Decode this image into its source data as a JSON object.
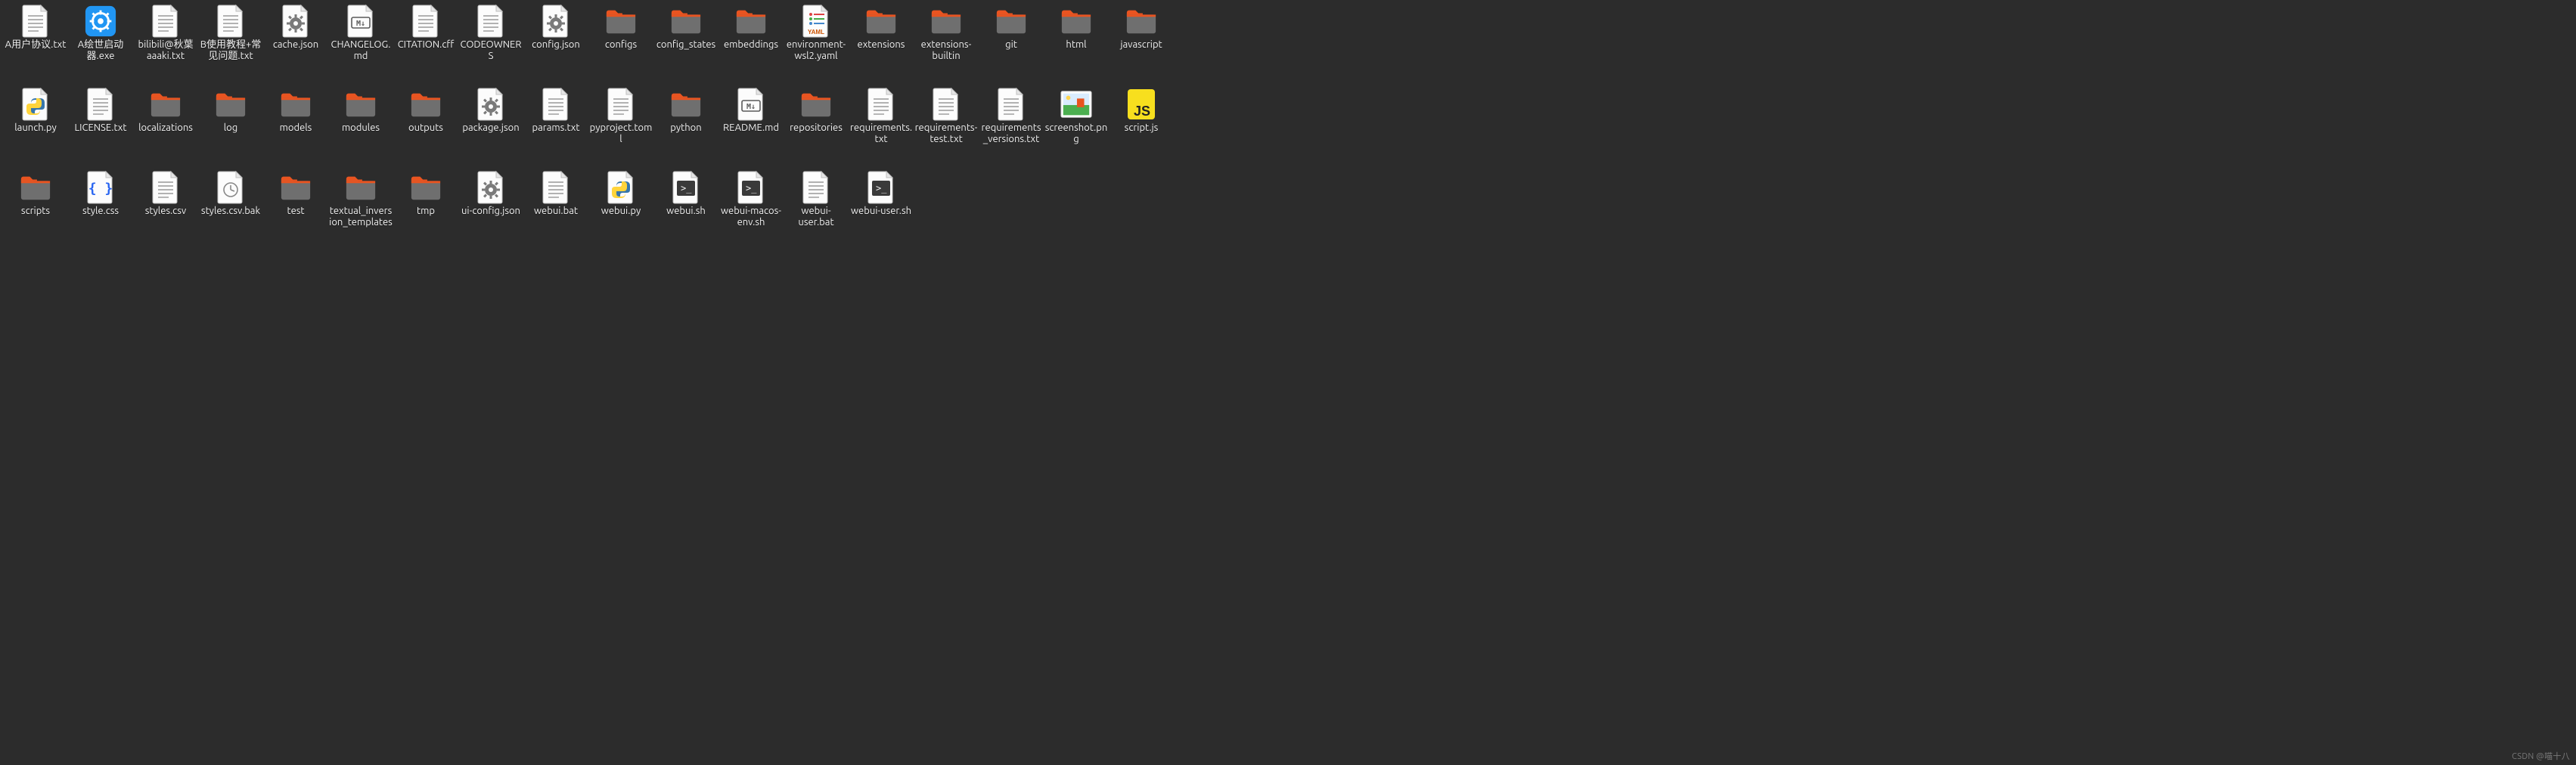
{
  "watermark": "CSDN @喵十八",
  "items": [
    {
      "label": "A用户协议.txt",
      "kind": "text"
    },
    {
      "label": "A绘世启动器.exe",
      "kind": "exe"
    },
    {
      "label": "bilibili@秋葉aaaki.txt",
      "kind": "text"
    },
    {
      "label": "B使用教程+常见问题.txt",
      "kind": "text"
    },
    {
      "label": "cache.json",
      "kind": "json-gear"
    },
    {
      "label": "CHANGELOG.md",
      "kind": "md"
    },
    {
      "label": "CITATION.cff",
      "kind": "text"
    },
    {
      "label": "CODEOWNERS",
      "kind": "text"
    },
    {
      "label": "config.json",
      "kind": "json-gear"
    },
    {
      "label": "configs",
      "kind": "folder"
    },
    {
      "label": "config_states",
      "kind": "folder"
    },
    {
      "label": "embeddings",
      "kind": "folder"
    },
    {
      "label": "environment-wsl2.yaml",
      "kind": "yaml"
    },
    {
      "label": "extensions",
      "kind": "folder"
    },
    {
      "label": "extensions-builtin",
      "kind": "folder"
    },
    {
      "label": "git",
      "kind": "folder"
    },
    {
      "label": "html",
      "kind": "folder"
    },
    {
      "label": "javascript",
      "kind": "folder"
    },
    {
      "label": "launch.py",
      "kind": "python"
    },
    {
      "label": "LICENSE.txt",
      "kind": "text"
    },
    {
      "label": "localizations",
      "kind": "folder"
    },
    {
      "label": "log",
      "kind": "folder"
    },
    {
      "label": "models",
      "kind": "folder"
    },
    {
      "label": "modules",
      "kind": "folder"
    },
    {
      "label": "outputs",
      "kind": "folder"
    },
    {
      "label": "package.json",
      "kind": "json-gear"
    },
    {
      "label": "params.txt",
      "kind": "text"
    },
    {
      "label": "pyproject.toml",
      "kind": "text"
    },
    {
      "label": "python",
      "kind": "folder"
    },
    {
      "label": "README.md",
      "kind": "md"
    },
    {
      "label": "repositories",
      "kind": "folder"
    },
    {
      "label": "requirements.txt",
      "kind": "text"
    },
    {
      "label": "requirements-test.txt",
      "kind": "text"
    },
    {
      "label": "requirements_versions.txt",
      "kind": "text"
    },
    {
      "label": "screenshot.png",
      "kind": "image"
    },
    {
      "label": "script.js",
      "kind": "js"
    },
    {
      "label": "scripts",
      "kind": "folder"
    },
    {
      "label": "style.css",
      "kind": "css"
    },
    {
      "label": "styles.csv",
      "kind": "text"
    },
    {
      "label": "styles.csv.bak",
      "kind": "bak"
    },
    {
      "label": "test",
      "kind": "folder"
    },
    {
      "label": "textual_inversion_templates",
      "kind": "folder"
    },
    {
      "label": "tmp",
      "kind": "folder"
    },
    {
      "label": "ui-config.json",
      "kind": "json-gear"
    },
    {
      "label": "webui.bat",
      "kind": "text"
    },
    {
      "label": "webui.py",
      "kind": "python"
    },
    {
      "label": "webui.sh",
      "kind": "shell"
    },
    {
      "label": "webui-macos-env.sh",
      "kind": "shell"
    },
    {
      "label": "webui-user.bat",
      "kind": "text"
    },
    {
      "label": "webui-user.sh",
      "kind": "shell"
    }
  ]
}
